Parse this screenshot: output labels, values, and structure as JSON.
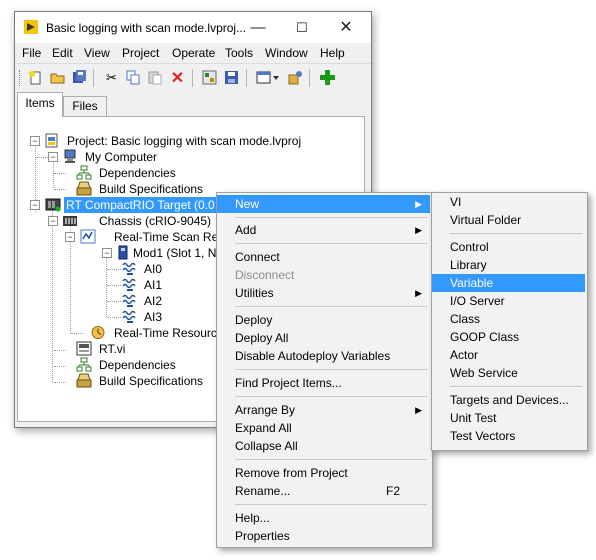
{
  "window": {
    "title": "Basic logging with scan mode.lvproj...",
    "minimize": "—",
    "maximize": "☐",
    "close": "✕"
  },
  "menubar": [
    "File",
    "Edit",
    "View",
    "Project",
    "Operate",
    "Tools",
    "Window",
    "Help"
  ],
  "tabs": {
    "items": "Items",
    "files": "Files"
  },
  "tree": {
    "project": "Project: Basic logging with scan mode.lvproj",
    "my_computer": "My Computer",
    "dependencies_1": "Dependencies",
    "build_specs_1": "Build Specifications",
    "rt_target": "RT CompactRIO Target (0.0.0.0)(Unconfigured IP Add",
    "chassis": "Chassis (cRIO-9045)",
    "scan_resources": "Real-Time Scan Resources",
    "mod1": "Mod1 (Slot 1, NI 9",
    "ai0": "AI0",
    "ai1": "AI1",
    "ai2": "AI2",
    "ai3": "AI3",
    "rt_resources": "Real-Time Resources",
    "rt_vi": "RT.vi",
    "dependencies_2": "Dependencies",
    "build_specs_2": "Build Specifications"
  },
  "context_menu": {
    "new": "New",
    "add": "Add",
    "connect": "Connect",
    "disconnect": "Disconnect",
    "utilities": "Utilities",
    "deploy": "Deploy",
    "deploy_all": "Deploy All",
    "disable_autodeploy": "Disable Autodeploy Variables",
    "find_project_items": "Find Project Items...",
    "arrange_by": "Arrange By",
    "expand_all": "Expand All",
    "collapse_all": "Collapse All",
    "remove_from_project": "Remove from Project",
    "rename": "Rename...",
    "rename_shortcut": "F2",
    "help": "Help...",
    "properties": "Properties"
  },
  "submenu_new": {
    "vi": "VI",
    "virtual_folder": "Virtual Folder",
    "control": "Control",
    "library": "Library",
    "variable": "Variable",
    "io_server": "I/O Server",
    "class": "Class",
    "goop_class": "GOOP Class",
    "actor": "Actor",
    "web_service": "Web Service",
    "targets_and_devices": "Targets and Devices...",
    "unit_test": "Unit Test",
    "test_vectors": "Test Vectors"
  },
  "icons": {
    "app": "labview-project-icon",
    "toolbar": [
      "new-icon",
      "open-icon",
      "save-all-icon",
      "cut-icon",
      "copy-icon",
      "paste-icon",
      "delete-icon",
      "build-icon",
      "save-project-icon",
      "view-icon",
      "properties-icon",
      "add-icon"
    ]
  },
  "colors": {
    "selection": "#3399ff",
    "menu_bg": "#f2f2f2",
    "delete_red": "#e02020",
    "add_green": "#1a9a1a"
  }
}
